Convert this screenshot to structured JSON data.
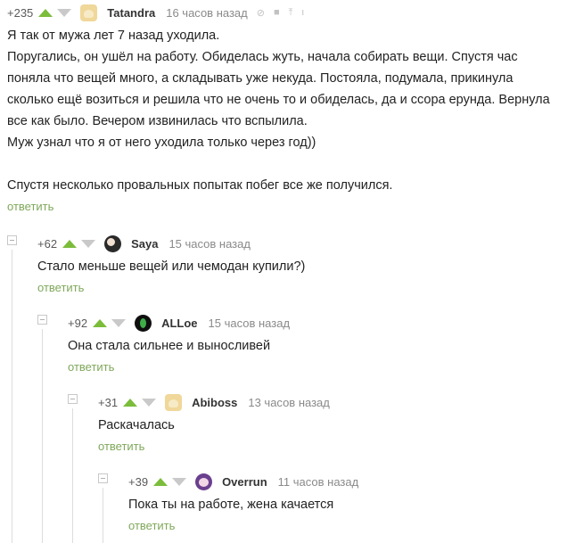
{
  "reply_label": "ответить",
  "comments": [
    {
      "rating": "+235",
      "author": "Tatandra",
      "time": "16 часов назад",
      "paragraphs": [
        "Я так от мужа лет 7 назад уходила.",
        "Поругались, он ушёл на работу. Обиделась жуть, начала собирать вещи. Спустя час поняла что вещей много, а складывать  уже некуда. Постояла, подумала, прикинула сколько ещё возиться и решила что не очень то и обиделась, да и ссора ерунда. Вернула все как было. Вечером извинилась что вспылила.",
        "Муж узнал что я от него уходила только через год))",
        "",
        "Спустя несколько провальных попытак побег все же получился."
      ]
    },
    {
      "rating": "+62",
      "author": "Saya",
      "time": "15 часов назад",
      "paragraphs": [
        "Стало меньше вещей или чемодан купили?)"
      ]
    },
    {
      "rating": "+92",
      "author": "ALLoe",
      "time": "15 часов назад",
      "paragraphs": [
        "Она стала сильнее и выносливей"
      ]
    },
    {
      "rating": "+31",
      "author": "Abiboss",
      "time": "13 часов назад",
      "paragraphs": [
        "Раскачалась"
      ]
    },
    {
      "rating": "+39",
      "author": "Overrun",
      "time": "11 часов назад",
      "paragraphs": [
        "Пока ты на работе, жена качается"
      ]
    }
  ],
  "colors": {
    "vote_up": "#7bbd3b",
    "vote_down": "#c9c9c9",
    "reply_link": "#7fa85a",
    "meta_time": "#8a8a8a"
  },
  "icons": [
    "link-icon",
    "save-icon",
    "share-icon",
    "more-icon",
    "collapse-icon"
  ]
}
